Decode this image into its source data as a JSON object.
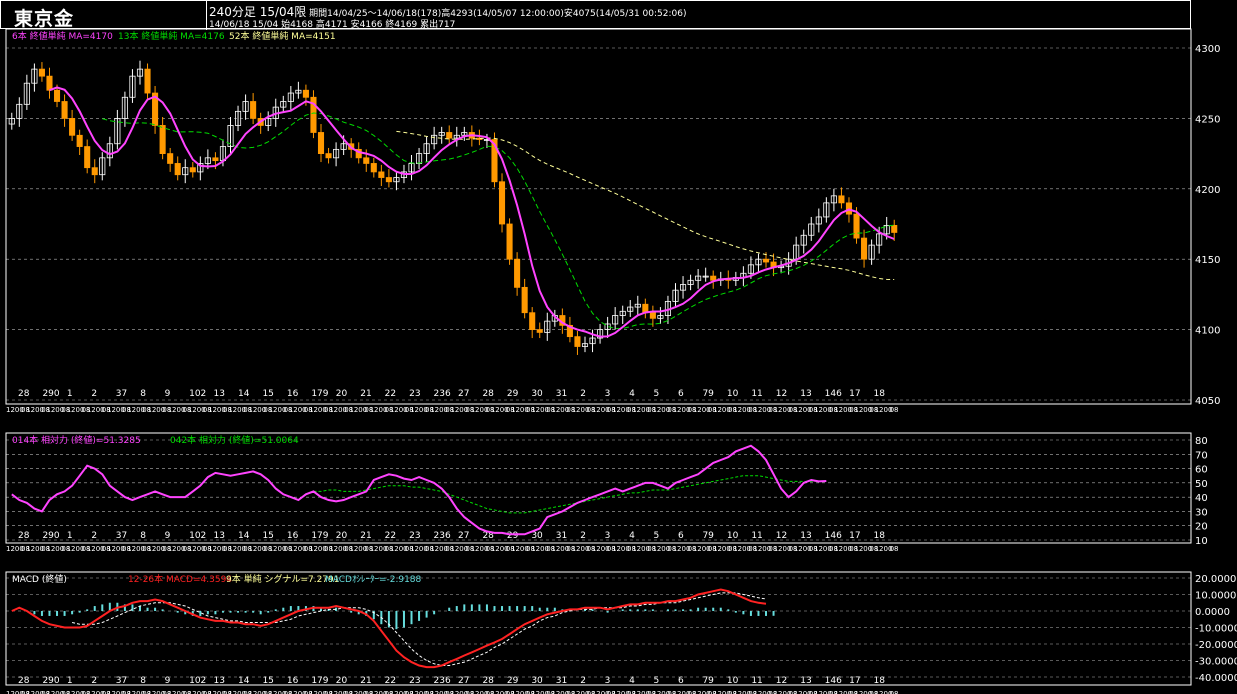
{
  "header": {
    "title": "東京金",
    "line1_main": "240分足 15/04限",
    "line1_rest": " 期間14/04/25～14/06/18(178)高4293(14/05/07 12:00:00)安4075(14/05/31 00:52:06)",
    "line2": "14/06/18 15/04 始4168 高4171 安4166 終4169 累出717"
  },
  "colors": {
    "background": "#000000",
    "candle_up": "#ffffff",
    "candle_down": "#ff9900",
    "ma6": "#ff44ff",
    "ma13": "#00dd00",
    "ma52": "#ffff99",
    "rsi14": "#ff44ff",
    "rsi42": "#00dd00",
    "macd": "#ff2222",
    "signal": "#ffffff",
    "osc": "#66dddd"
  },
  "chart_data": [
    {
      "type": "candlestick",
      "legend": [
        "6本 終値単純 MA=4170",
        "13本 終値単純 MA=4176",
        "52本 終値単純 MA=4151"
      ],
      "ylim": [
        4050,
        4300
      ],
      "yticks": [
        "4300",
        "4250",
        "4200",
        "4150",
        "4100",
        "4050"
      ],
      "grid": true,
      "day_labels": [
        "28",
        "290",
        "1",
        "2",
        "37",
        "8",
        "9",
        "102",
        "13",
        "14",
        "15",
        "16",
        "179",
        "20",
        "21",
        "22",
        "23",
        "236",
        "27",
        "28",
        "29",
        "30",
        "31",
        "2",
        "3",
        "4",
        "5",
        "6",
        "79",
        "10",
        "11",
        "12",
        "13",
        "146",
        "17",
        "18"
      ],
      "time_labels_note": "12:00:08 repeated across axis",
      "close_series": [
        4250,
        4260,
        4275,
        4285,
        4280,
        4270,
        4262,
        4250,
        4238,
        4230,
        4215,
        4210,
        4222,
        4232,
        4250,
        4265,
        4280,
        4285,
        4268,
        4245,
        4225,
        4218,
        4210,
        4215,
        4212,
        4218,
        4222,
        4220,
        4230,
        4245,
        4255,
        4262,
        4250,
        4245,
        4250,
        4258,
        4262,
        4268,
        4270,
        4265,
        4240,
        4225,
        4222,
        4228,
        4232,
        4228,
        4222,
        4218,
        4212,
        4208,
        4205,
        4208,
        4212,
        4218,
        4225,
        4232,
        4238,
        4240,
        4236,
        4238,
        4240,
        4236,
        4235,
        4235,
        4205,
        4175,
        4150,
        4130,
        4112,
        4100,
        4098,
        4106,
        4110,
        4103,
        4095,
        4088,
        4090,
        4094,
        4100,
        4104,
        4110,
        4113,
        4116,
        4118,
        4112,
        4108,
        4110,
        4120,
        4128,
        4132,
        4135,
        4138,
        4138,
        4135,
        4136,
        4135,
        4137,
        4140,
        4146,
        4150,
        4148,
        4144,
        4145,
        4150,
        4160,
        4167,
        4175,
        4180,
        4190,
        4195,
        4190,
        4182,
        4165,
        4150,
        4160,
        4168,
        4174,
        4169
      ],
      "ma_legend_values": {
        "ma6": "4170",
        "ma13": "4176",
        "ma52": "4151"
      }
    },
    {
      "type": "line",
      "legend": [
        "014本 相対力 (終値)=51.3285",
        "042本 相対力 (終値)=51.0064"
      ],
      "ylim": [
        10,
        80
      ],
      "yticks": [
        "80",
        "70",
        "60",
        "50",
        "40",
        "30",
        "20",
        "10"
      ],
      "series": [
        {
          "name": "014本 相対力 (終値)",
          "values": [
            42,
            38,
            36,
            32,
            30,
            38,
            42,
            44,
            48,
            55,
            62,
            60,
            56,
            48,
            44,
            40,
            38,
            40,
            42,
            44,
            42,
            40,
            40,
            40,
            44,
            48,
            54,
            57,
            56,
            55,
            56,
            57,
            58,
            56,
            52,
            46,
            42,
            40,
            38,
            42,
            44,
            40,
            38,
            37,
            38,
            40,
            42,
            44,
            52,
            54,
            56,
            55,
            53,
            52,
            54,
            52,
            50,
            46,
            40,
            32,
            26,
            22,
            18,
            16,
            15,
            15,
            14,
            14,
            14,
            16,
            18,
            26,
            28,
            30,
            33,
            36,
            38,
            40,
            42,
            44,
            46,
            44,
            46,
            48,
            50,
            50,
            48,
            46,
            50,
            52,
            54,
            56,
            60,
            64,
            66,
            68,
            72,
            74,
            76,
            72,
            66,
            56,
            46,
            40,
            44,
            50,
            52,
            51,
            51.3
          ]
        },
        {
          "name": "042本 相対力 (終値)",
          "values": [
            null,
            null,
            null,
            null,
            null,
            null,
            null,
            null,
            null,
            null,
            null,
            null,
            null,
            null,
            null,
            null,
            null,
            null,
            null,
            null,
            null,
            null,
            null,
            null,
            null,
            null,
            null,
            null,
            null,
            null,
            null,
            null,
            null,
            null,
            null,
            null,
            null,
            null,
            null,
            null,
            44,
            44,
            45,
            45,
            44,
            44,
            44,
            45,
            46,
            47,
            48,
            48,
            48,
            47,
            47,
            46,
            45,
            44,
            42,
            40,
            38,
            36,
            34,
            32,
            31,
            30,
            29,
            29,
            29,
            30,
            31,
            32,
            33,
            34,
            35,
            36,
            37,
            38,
            39,
            40,
            41,
            42,
            43,
            43,
            44,
            45,
            45,
            45,
            46,
            47,
            48,
            49,
            50,
            51,
            52,
            53,
            54,
            55,
            55,
            55,
            54,
            53,
            52,
            51,
            51,
            51,
            51,
            51,
            51.0
          ]
        }
      ]
    },
    {
      "type": "line",
      "legend": [
        "MACD (終値)",
        "12-26本 MACD=4.3594",
        "9本 単純 シグナル=7.2791",
        "MACDｵｼﾚｰﾀｰ=-2.9188"
      ],
      "ylim": [
        -40,
        20
      ],
      "yticks": [
        "20.0000",
        "10.0000",
        "0.0000",
        "-10.0000",
        "-20.0000",
        "-30.0000",
        "-40.0000"
      ],
      "series": [
        {
          "name": "MACD",
          "values": [
            0,
            2,
            0,
            -3,
            -6,
            -8,
            -9,
            -10,
            -10,
            -10,
            -9,
            -6,
            -3,
            0,
            2,
            3,
            5,
            6,
            6,
            7,
            6,
            4,
            2,
            0,
            -2,
            -4,
            -5,
            -6,
            -6,
            -7,
            -7,
            -8,
            -8,
            -9,
            -8,
            -6,
            -4,
            -2,
            0,
            1,
            2,
            2,
            2,
            3,
            2,
            1,
            0,
            -2,
            -6,
            -12,
            -18,
            -24,
            -28,
            -31,
            -33,
            -34,
            -34,
            -33,
            -31,
            -29,
            -27,
            -25,
            -23,
            -21,
            -19,
            -17,
            -14,
            -11,
            -8,
            -6,
            -4,
            -2,
            -1,
            0,
            1,
            1,
            2,
            2,
            2,
            1,
            2,
            3,
            4,
            4,
            5,
            5,
            5,
            6,
            6,
            7,
            8,
            10,
            11,
            12,
            13,
            12,
            10,
            8,
            6,
            5,
            4.4
          ]
        },
        {
          "name": "シグナル",
          "values": [
            null,
            null,
            null,
            null,
            null,
            null,
            null,
            null,
            -7,
            -8,
            -8,
            -8,
            -7,
            -5,
            -3,
            -1,
            1,
            3,
            4,
            5,
            5,
            5,
            4,
            3,
            1,
            -1,
            -3,
            -4,
            -5,
            -6,
            -6,
            -7,
            -7,
            -7,
            -7,
            -7,
            -6,
            -5,
            -3,
            -2,
            -1,
            0,
            1,
            1,
            2,
            2,
            2,
            1,
            -1,
            -4,
            -8,
            -13,
            -18,
            -23,
            -27,
            -30,
            -32,
            -33,
            -33,
            -32,
            -31,
            -29,
            -27,
            -25,
            -22,
            -20,
            -17,
            -14,
            -11,
            -9,
            -6,
            -4,
            -3,
            -1,
            0,
            1,
            1,
            1,
            2,
            2,
            2,
            2,
            3,
            3,
            4,
            4,
            5,
            5,
            5,
            6,
            7,
            8,
            9,
            10,
            11,
            11,
            11,
            10,
            9,
            8,
            7.3
          ]
        }
      ],
      "oscillator": [
        0,
        0,
        0,
        -2,
        -3,
        -3,
        -3,
        -3,
        -2,
        -1,
        1,
        3,
        4,
        5,
        5,
        4,
        4,
        3,
        2,
        2,
        1,
        0,
        -1,
        -2,
        -3,
        -3,
        -2,
        -2,
        -1,
        -1,
        -1,
        -1,
        -1,
        -2,
        -1,
        1,
        2,
        3,
        3,
        3,
        3,
        2,
        1,
        2,
        0,
        -1,
        -2,
        -3,
        -5,
        -8,
        -10,
        -11,
        -10,
        -8,
        -6,
        -4,
        -2,
        0,
        2,
        3,
        4,
        4,
        4,
        4,
        3,
        3,
        3,
        3,
        3,
        3,
        2,
        2,
        2,
        1,
        1,
        0,
        1,
        1,
        0,
        -1,
        0,
        1,
        1,
        1,
        1,
        1,
        0,
        1,
        1,
        1,
        1,
        2,
        2,
        2,
        2,
        1,
        -1,
        -2,
        -3,
        -3,
        -3,
        -2.9
      ]
    }
  ]
}
